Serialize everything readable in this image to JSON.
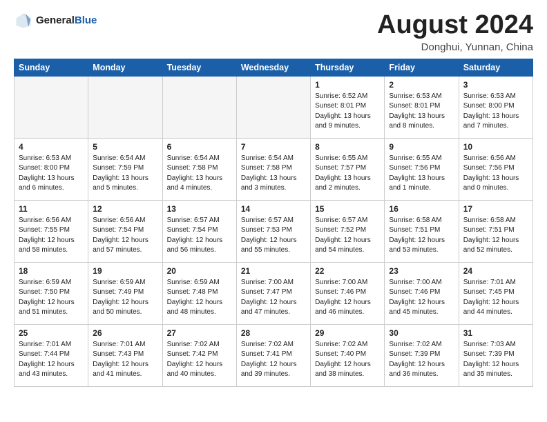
{
  "header": {
    "logo_general": "General",
    "logo_blue": "Blue",
    "month_title": "August 2024",
    "location": "Donghui, Yunnan, China"
  },
  "days_of_week": [
    "Sunday",
    "Monday",
    "Tuesday",
    "Wednesday",
    "Thursday",
    "Friday",
    "Saturday"
  ],
  "weeks": [
    [
      {
        "day": "",
        "info": ""
      },
      {
        "day": "",
        "info": ""
      },
      {
        "day": "",
        "info": ""
      },
      {
        "day": "",
        "info": ""
      },
      {
        "day": "1",
        "info": "Sunrise: 6:52 AM\nSunset: 8:01 PM\nDaylight: 13 hours and 9 minutes."
      },
      {
        "day": "2",
        "info": "Sunrise: 6:53 AM\nSunset: 8:01 PM\nDaylight: 13 hours and 8 minutes."
      },
      {
        "day": "3",
        "info": "Sunrise: 6:53 AM\nSunset: 8:00 PM\nDaylight: 13 hours and 7 minutes."
      }
    ],
    [
      {
        "day": "4",
        "info": "Sunrise: 6:53 AM\nSunset: 8:00 PM\nDaylight: 13 hours and 6 minutes."
      },
      {
        "day": "5",
        "info": "Sunrise: 6:54 AM\nSunset: 7:59 PM\nDaylight: 13 hours and 5 minutes."
      },
      {
        "day": "6",
        "info": "Sunrise: 6:54 AM\nSunset: 7:58 PM\nDaylight: 13 hours and 4 minutes."
      },
      {
        "day": "7",
        "info": "Sunrise: 6:54 AM\nSunset: 7:58 PM\nDaylight: 13 hours and 3 minutes."
      },
      {
        "day": "8",
        "info": "Sunrise: 6:55 AM\nSunset: 7:57 PM\nDaylight: 13 hours and 2 minutes."
      },
      {
        "day": "9",
        "info": "Sunrise: 6:55 AM\nSunset: 7:56 PM\nDaylight: 13 hours and 1 minute."
      },
      {
        "day": "10",
        "info": "Sunrise: 6:56 AM\nSunset: 7:56 PM\nDaylight: 13 hours and 0 minutes."
      }
    ],
    [
      {
        "day": "11",
        "info": "Sunrise: 6:56 AM\nSunset: 7:55 PM\nDaylight: 12 hours and 58 minutes."
      },
      {
        "day": "12",
        "info": "Sunrise: 6:56 AM\nSunset: 7:54 PM\nDaylight: 12 hours and 57 minutes."
      },
      {
        "day": "13",
        "info": "Sunrise: 6:57 AM\nSunset: 7:54 PM\nDaylight: 12 hours and 56 minutes."
      },
      {
        "day": "14",
        "info": "Sunrise: 6:57 AM\nSunset: 7:53 PM\nDaylight: 12 hours and 55 minutes."
      },
      {
        "day": "15",
        "info": "Sunrise: 6:57 AM\nSunset: 7:52 PM\nDaylight: 12 hours and 54 minutes."
      },
      {
        "day": "16",
        "info": "Sunrise: 6:58 AM\nSunset: 7:51 PM\nDaylight: 12 hours and 53 minutes."
      },
      {
        "day": "17",
        "info": "Sunrise: 6:58 AM\nSunset: 7:51 PM\nDaylight: 12 hours and 52 minutes."
      }
    ],
    [
      {
        "day": "18",
        "info": "Sunrise: 6:59 AM\nSunset: 7:50 PM\nDaylight: 12 hours and 51 minutes."
      },
      {
        "day": "19",
        "info": "Sunrise: 6:59 AM\nSunset: 7:49 PM\nDaylight: 12 hours and 50 minutes."
      },
      {
        "day": "20",
        "info": "Sunrise: 6:59 AM\nSunset: 7:48 PM\nDaylight: 12 hours and 48 minutes."
      },
      {
        "day": "21",
        "info": "Sunrise: 7:00 AM\nSunset: 7:47 PM\nDaylight: 12 hours and 47 minutes."
      },
      {
        "day": "22",
        "info": "Sunrise: 7:00 AM\nSunset: 7:46 PM\nDaylight: 12 hours and 46 minutes."
      },
      {
        "day": "23",
        "info": "Sunrise: 7:00 AM\nSunset: 7:46 PM\nDaylight: 12 hours and 45 minutes."
      },
      {
        "day": "24",
        "info": "Sunrise: 7:01 AM\nSunset: 7:45 PM\nDaylight: 12 hours and 44 minutes."
      }
    ],
    [
      {
        "day": "25",
        "info": "Sunrise: 7:01 AM\nSunset: 7:44 PM\nDaylight: 12 hours and 43 minutes."
      },
      {
        "day": "26",
        "info": "Sunrise: 7:01 AM\nSunset: 7:43 PM\nDaylight: 12 hours and 41 minutes."
      },
      {
        "day": "27",
        "info": "Sunrise: 7:02 AM\nSunset: 7:42 PM\nDaylight: 12 hours and 40 minutes."
      },
      {
        "day": "28",
        "info": "Sunrise: 7:02 AM\nSunset: 7:41 PM\nDaylight: 12 hours and 39 minutes."
      },
      {
        "day": "29",
        "info": "Sunrise: 7:02 AM\nSunset: 7:40 PM\nDaylight: 12 hours and 38 minutes."
      },
      {
        "day": "30",
        "info": "Sunrise: 7:02 AM\nSunset: 7:39 PM\nDaylight: 12 hours and 36 minutes."
      },
      {
        "day": "31",
        "info": "Sunrise: 7:03 AM\nSunset: 7:39 PM\nDaylight: 12 hours and 35 minutes."
      }
    ]
  ]
}
